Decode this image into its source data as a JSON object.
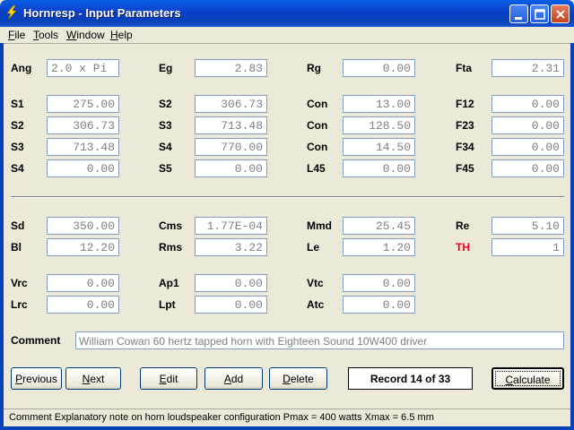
{
  "window": {
    "title": "Hornresp - Input Parameters",
    "icon": "lightning-bolt-icon"
  },
  "menu": [
    {
      "label": "File",
      "accel": "F",
      "rest": "ile"
    },
    {
      "label": "Tools",
      "accel": "T",
      "rest": "ools"
    },
    {
      "label": "Window",
      "accel": "W",
      "rest": "indow"
    },
    {
      "label": "Help",
      "accel": "H",
      "rest": "elp"
    }
  ],
  "params": {
    "ang": {
      "label": "Ang",
      "value": "2.0 x Pi"
    },
    "eg": {
      "label": "Eg",
      "value": "2.83"
    },
    "rg": {
      "label": "Rg",
      "value": "0.00"
    },
    "fta": {
      "label": "Fta",
      "value": "2.31"
    },
    "s1": {
      "label": "S1",
      "value": "275.00"
    },
    "s2a": {
      "label": "S2",
      "value": "306.73"
    },
    "con1": {
      "label": "Con",
      "value": "13.00"
    },
    "f12": {
      "label": "F12",
      "value": "0.00"
    },
    "s2b": {
      "label": "S2",
      "value": "306.73"
    },
    "s3a": {
      "label": "S3",
      "value": "713.48"
    },
    "con2": {
      "label": "Con",
      "value": "128.50"
    },
    "f23": {
      "label": "F23",
      "value": "0.00"
    },
    "s3b": {
      "label": "S3",
      "value": "713.48"
    },
    "s4a": {
      "label": "S4",
      "value": "770.00"
    },
    "con3": {
      "label": "Con",
      "value": "14.50"
    },
    "f34": {
      "label": "F34",
      "value": "0.00"
    },
    "s4b": {
      "label": "S4",
      "value": "0.00"
    },
    "s5": {
      "label": "S5",
      "value": "0.00"
    },
    "l45": {
      "label": "L45",
      "value": "0.00"
    },
    "f45": {
      "label": "F45",
      "value": "0.00"
    },
    "sd": {
      "label": "Sd",
      "value": "350.00"
    },
    "cms": {
      "label": "Cms",
      "value": "1.77E-04"
    },
    "mmd": {
      "label": "Mmd",
      "value": "25.45"
    },
    "re": {
      "label": "Re",
      "value": "5.10"
    },
    "bl": {
      "label": "Bl",
      "value": "12.20"
    },
    "rms": {
      "label": "Rms",
      "value": "3.22"
    },
    "le": {
      "label": "Le",
      "value": "1.20"
    },
    "th": {
      "label": "TH",
      "value": "1"
    },
    "vrc": {
      "label": "Vrc",
      "value": "0.00"
    },
    "ap1": {
      "label": "Ap1",
      "value": "0.00"
    },
    "vtc": {
      "label": "Vtc",
      "value": "0.00"
    },
    "lrc": {
      "label": "Lrc",
      "value": "0.00"
    },
    "lpt": {
      "label": "Lpt",
      "value": "0.00"
    },
    "atc": {
      "label": "Atc",
      "value": "0.00"
    }
  },
  "comment": {
    "label": "Comment",
    "value": "William Cowan 60 hertz tapped horn with Eighteen Sound 10W400 driver"
  },
  "buttons": {
    "previous": {
      "accel": "P",
      "rest": "revious"
    },
    "next": {
      "accel": "N",
      "rest": "ext"
    },
    "edit": {
      "accel": "E",
      "rest": "dit"
    },
    "add": {
      "accel": "A",
      "rest": "dd"
    },
    "delete": {
      "accel": "D",
      "rest": "elete"
    },
    "calculate": {
      "accel": "C",
      "rest": "alculate"
    }
  },
  "record": "Record 14 of 33",
  "status": "Comment   Explanatory note on horn loudspeaker configuration   Pmax = 400 watts   Xmax = 6.5 mm",
  "colors": {
    "titlebar": "#0a3fc8",
    "th_label": "#e8001c",
    "field_text": "#808080"
  }
}
